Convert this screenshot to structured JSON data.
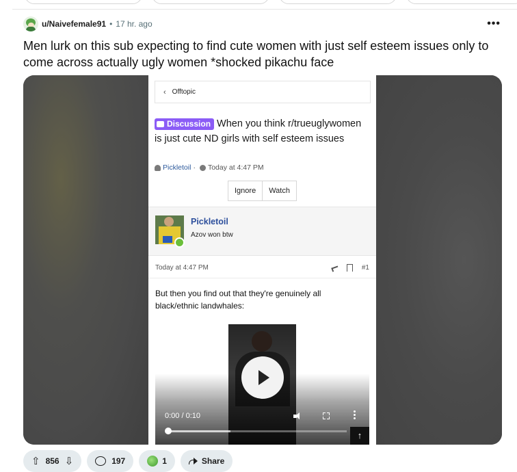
{
  "post": {
    "username": "u/Naivefemale91",
    "separator": "•",
    "time": "17 hr. ago",
    "more": "•••",
    "title": "Men lurk on this sub expecting to find cute women with just self esteem issues only to come across actually ugly women *shocked pikachu face"
  },
  "screenshot": {
    "breadcrumb": "Offtopic",
    "prefix_label": "Discussion",
    "thread_title": "When you think r/trueuglywomen is just cute ND girls with self esteem issues",
    "author": "Pickletoil",
    "meta_sep": "·",
    "date": "Today at 4:47 PM",
    "buttons": [
      "Ignore",
      "Watch"
    ],
    "message": {
      "author": "Pickletoil",
      "user_title": "Azov won btw",
      "date": "Today at 4:47 PM",
      "number": "#1",
      "body": "But then you find out that they're genuinely all black/ethnic landwhales:"
    },
    "video": {
      "time": "0:00 / 0:10",
      "progress_fraction": 0.0,
      "buffered_fraction": 0.35
    },
    "scroll_top": "↑"
  },
  "actions": {
    "upvotes": "856",
    "comments": "197",
    "awards": "1",
    "share": "Share"
  },
  "icons": {
    "upvote": "upvote-icon",
    "downvote": "downvote-icon",
    "comment": "comment-icon",
    "award": "award-icon",
    "share": "share-icon"
  },
  "colors": {
    "badge": "#8b5cf6",
    "link": "#2d4f9c",
    "pill_bg": "#e5ebee"
  }
}
